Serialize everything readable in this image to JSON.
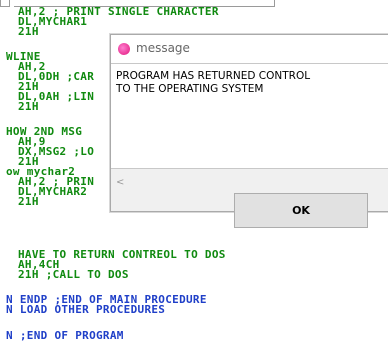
{
  "editor": {
    "lines": [
      {
        "text": "AH,2 ; PRINT SINGLE CHARACTER",
        "color": "#108a10"
      },
      {
        "text": "DL,MYCHAR1",
        "color": "#108a10"
      },
      {
        "text": "21H",
        "color": "#108a10"
      },
      {
        "text": "",
        "color": "#108a10"
      },
      {
        "text": "WLINE",
        "color": "#108a10"
      },
      {
        "text": "AH,2",
        "color": "#108a10"
      },
      {
        "text": "DL,0DH ;CAR",
        "color": "#108a10"
      },
      {
        "text": "21H",
        "color": "#108a10"
      },
      {
        "text": "DL,0AH ;LIN",
        "color": "#108a10"
      },
      {
        "text": "21H",
        "color": "#108a10"
      },
      {
        "text": "",
        "color": "#108a10"
      },
      {
        "text": "HOW 2ND MSG",
        "color": "#108a10"
      },
      {
        "text": "AH,9",
        "color": "#108a10"
      },
      {
        "text": "DX,MSG2 ;LO",
        "color": "#108a10"
      },
      {
        "text": "21H",
        "color": "#108a10"
      },
      {
        "text": "ow mychar2",
        "color": "#108a10"
      },
      {
        "text": "AH,2 ; PRIN",
        "color": "#108a10"
      },
      {
        "text": "DL,MYCHAR2",
        "color": "#108a10"
      },
      {
        "text": "21H",
        "color": "#108a10"
      },
      {
        "text": "",
        "color": "#108a10"
      },
      {
        "text": "",
        "color": "#108a10"
      },
      {
        "text": "HAVE TO RETURN CONTREOL TO DOS",
        "color": "#108a10"
      },
      {
        "text": "AH,4CH",
        "color": "#108a10"
      },
      {
        "text": "21H ;CALL TO DOS",
        "color": "#108a10"
      },
      {
        "text": "",
        "color": "#108a10"
      },
      {
        "text": "N ENDP ;END OF MAIN PROCEDURE",
        "color": "#1f3fc8"
      },
      {
        "text": "N LOAD OTHER PROCEDURES",
        "color": "#1f3fc8"
      },
      {
        "text": "",
        "color": "#108a10"
      },
      {
        "text": "N ;END OF PROGRAM",
        "color": "#1f3fc8"
      }
    ]
  },
  "dialog": {
    "title": "message",
    "message_line1": "PROGRAM HAS RETURNED CONTROL",
    "message_line2": "TO THE OPERATING SYSTEM",
    "scroll_left_glyph": "<",
    "ok_label": "OK",
    "icon": "app-icon",
    "icon_color": "#e0147a"
  }
}
